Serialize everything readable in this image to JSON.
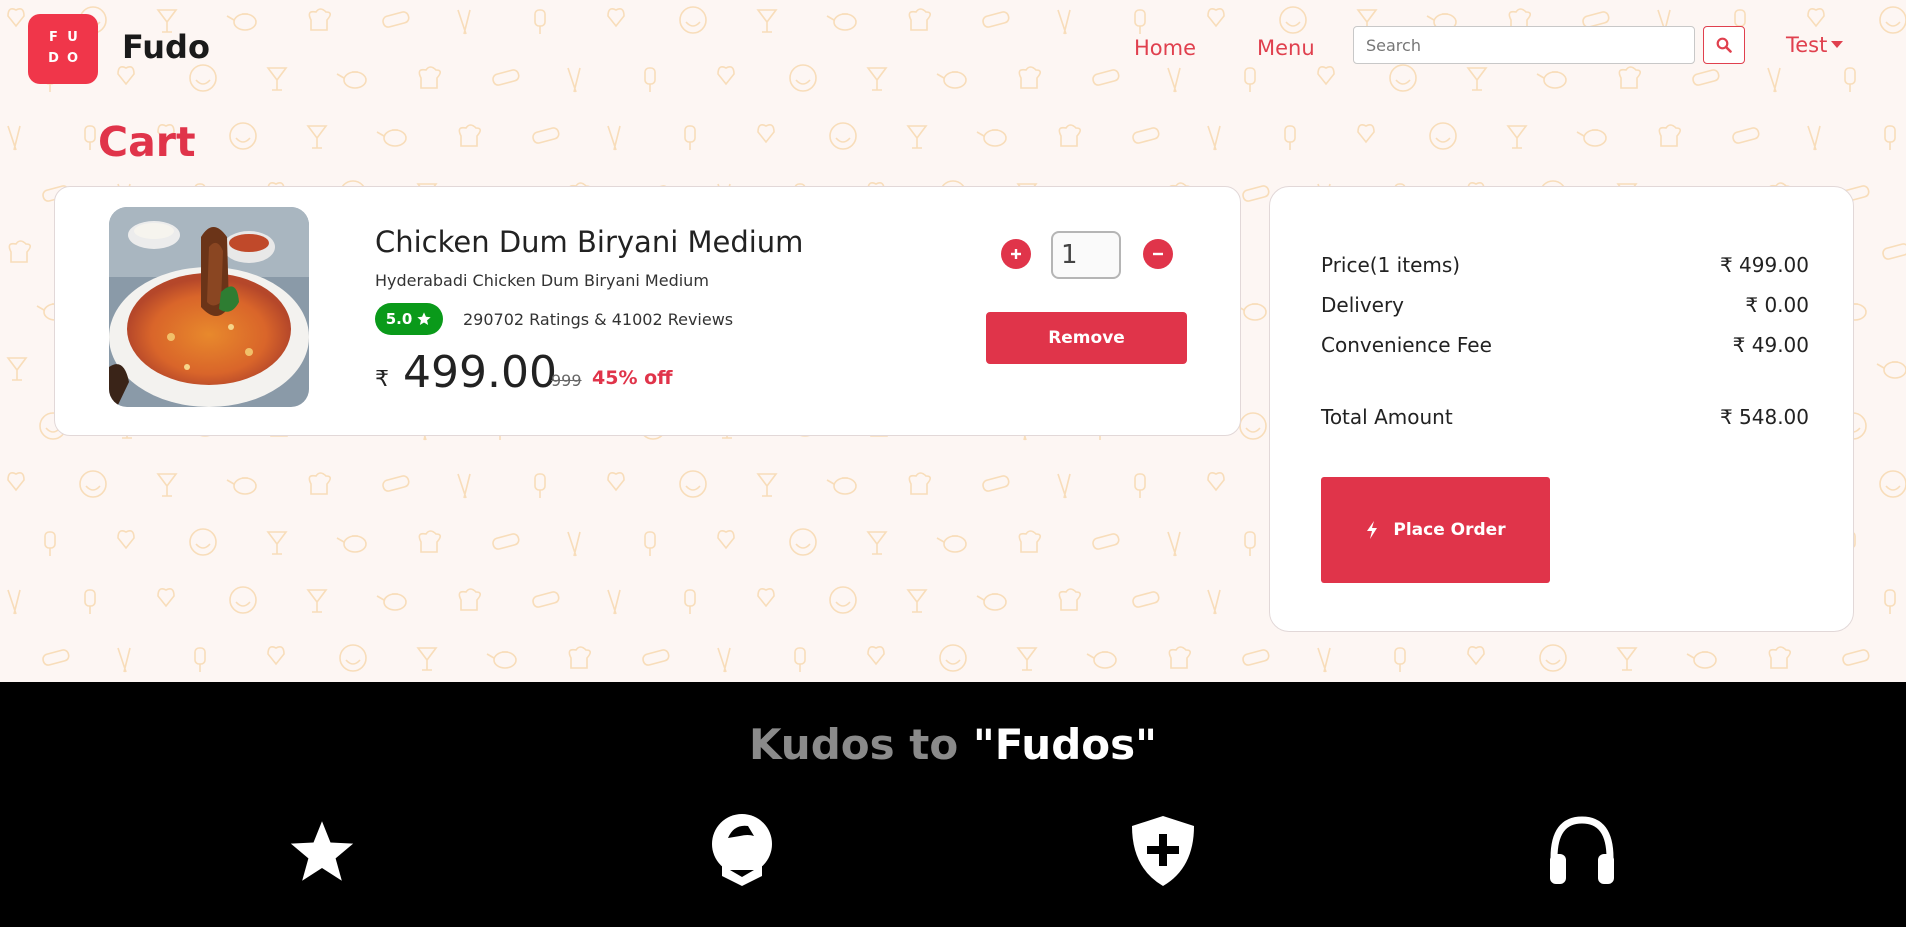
{
  "nav": {
    "logo_letters": [
      "F",
      "U",
      "D",
      "O"
    ],
    "brand": "Fudo",
    "links": [
      "Home",
      "Menu"
    ],
    "search_placeholder": "Search",
    "user": "Test"
  },
  "cart": {
    "title": "Cart",
    "item": {
      "name": "Chicken Dum Biryani Medium",
      "description": "Hyderabadi Chicken Dum Biryani Medium",
      "rating": "5.0",
      "ratings_text": "290702 Ratings & 41002 Reviews",
      "currency": "₹",
      "price": "499.00",
      "original_price": "999",
      "discount": "45% off",
      "quantity": "1",
      "remove_label": "Remove"
    }
  },
  "summary": {
    "rows": [
      {
        "label": "Price(1 items)",
        "value": "₹ 499.00"
      },
      {
        "label": "Delivery",
        "value": "₹ 0.00"
      },
      {
        "label": "Convenience Fee",
        "value": "₹ 49.00"
      }
    ],
    "total_label": "Total Amount",
    "total_value": "₹ 548.00",
    "place_order_label": "Place Order"
  },
  "footer": {
    "kudos_prefix": "Kudos to ",
    "kudos_highlight": "\"Fudos\"",
    "icons": [
      "star-icon",
      "chef-hat-icon",
      "shield-plus-icon",
      "headphones-icon"
    ]
  },
  "colors": {
    "accent": "#e0344a",
    "rating_green": "#0a9a1a",
    "footer_bg": "#000000",
    "pattern": "#f5c98a"
  }
}
